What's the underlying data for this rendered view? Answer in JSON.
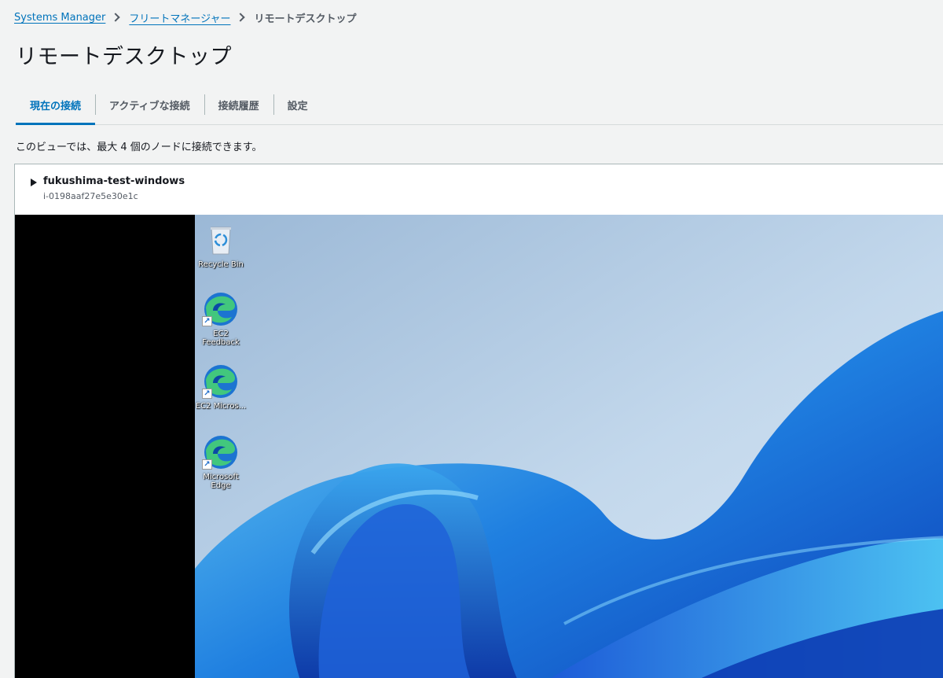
{
  "breadcrumb": {
    "items": [
      {
        "label": "Systems Manager"
      },
      {
        "label": "フリートマネージャー"
      }
    ],
    "current": "リモートデスクトップ"
  },
  "page": {
    "title": "リモートデスクトップ"
  },
  "tabs": [
    {
      "label": "現在の接続",
      "active": true
    },
    {
      "label": "アクティブな接続",
      "active": false
    },
    {
      "label": "接続履歴",
      "active": false
    },
    {
      "label": "設定",
      "active": false
    }
  ],
  "info_text": "このビューでは、最大 4 個のノードに接続できます。",
  "session": {
    "instance_name": "fukushima-test-windows",
    "instance_id": "i-0198aaf27e5e30e1c",
    "desktop_icons": [
      {
        "label": "Recycle Bin",
        "icon": "recycle-bin-icon"
      },
      {
        "label": "EC2 Feedback",
        "icon": "edge-icon"
      },
      {
        "label": "EC2 Micros...",
        "icon": "edge-icon"
      },
      {
        "label": "Microsoft Edge",
        "icon": "edge-icon"
      }
    ]
  },
  "colors": {
    "link": "#0073bb",
    "active_tab": "#0073bb",
    "background": "#f2f3f3"
  }
}
